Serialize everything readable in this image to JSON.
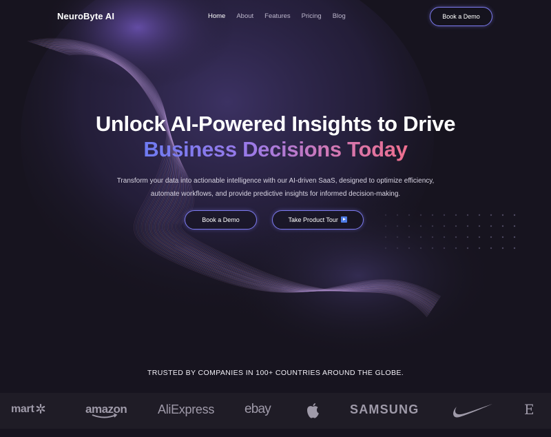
{
  "header": {
    "logo": "NeuroByte AI",
    "nav": [
      "Home",
      "About",
      "Features",
      "Pricing",
      "Blog"
    ],
    "cta": "Book a Demo"
  },
  "hero": {
    "title_line1": "Unlock AI-Powered Insights to Drive",
    "title_line2": "Business Decisions Today",
    "subtitle_line1": "Transform your data into actionable intelligence with our AI-driven SaaS, designed to optimize efficiency,",
    "subtitle_line2": "automate workflows, and provide predictive insights for informed decision-making.",
    "primary_cta": "Book a Demo",
    "secondary_cta": "Take Product Tour"
  },
  "trusted": {
    "text": "TRUSTED BY COMPANIES IN 100+ COUNTRIES AROUND THE GLOBE.",
    "logos": [
      "mart",
      "amazon",
      "AliExpress",
      "ebay",
      "apple-logo",
      "SAMSUNG",
      "nike-swoosh",
      "E"
    ]
  },
  "colors": {
    "background": "#17141f",
    "accent": "#7d7bf0",
    "gradient_start": "#6e7bf2",
    "gradient_end": "#ee6f8e"
  }
}
